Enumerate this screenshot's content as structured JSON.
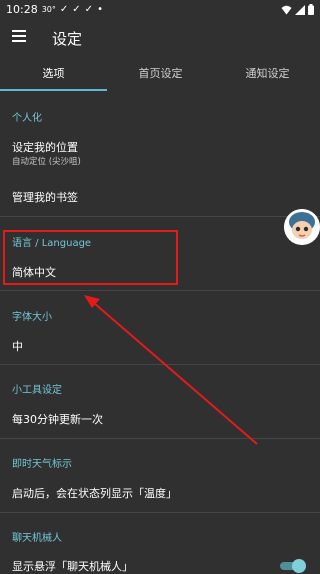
{
  "status_bar": {
    "time": "10:28",
    "temperature": "30°",
    "notification_icons": [
      "check-mark-icon",
      "check-mark-icon",
      "check-mark-icon"
    ],
    "dot": "•",
    "wifi_icon": "wifi-icon",
    "signal_icon": "signal-icon",
    "battery_icon": "battery-icon"
  },
  "app_bar": {
    "menu_icon": "hamburger-menu-icon",
    "title": "设定"
  },
  "tabs": [
    {
      "label": "选项",
      "active": true
    },
    {
      "label": "首页设定",
      "active": false
    },
    {
      "label": "通知设定",
      "active": false
    }
  ],
  "sections": {
    "personalization": {
      "header": "个人化",
      "location_title": "设定我的位置",
      "location_subtitle": "自动定位 (尖沙咀)",
      "bookmarks_title": "管理我的书签"
    },
    "language": {
      "header": "语言 / Language",
      "value": "简体中文"
    },
    "font_size": {
      "header": "字体大小",
      "value": "中"
    },
    "widget": {
      "header": "小工具设定",
      "value": "每30分钟更新一次"
    },
    "weather_indicator": {
      "header": "即时天气标示",
      "value": "启动后，会在状态列显示「温度」"
    },
    "chatbot": {
      "header": "聊天机械人",
      "value": "显示悬浮「聊天机械人」",
      "toggle_on": true
    }
  },
  "colors": {
    "background": "#303030",
    "accent": "#72c7d6",
    "tab_indicator": "#5fb8d6",
    "annotation": "#e31b1b"
  }
}
